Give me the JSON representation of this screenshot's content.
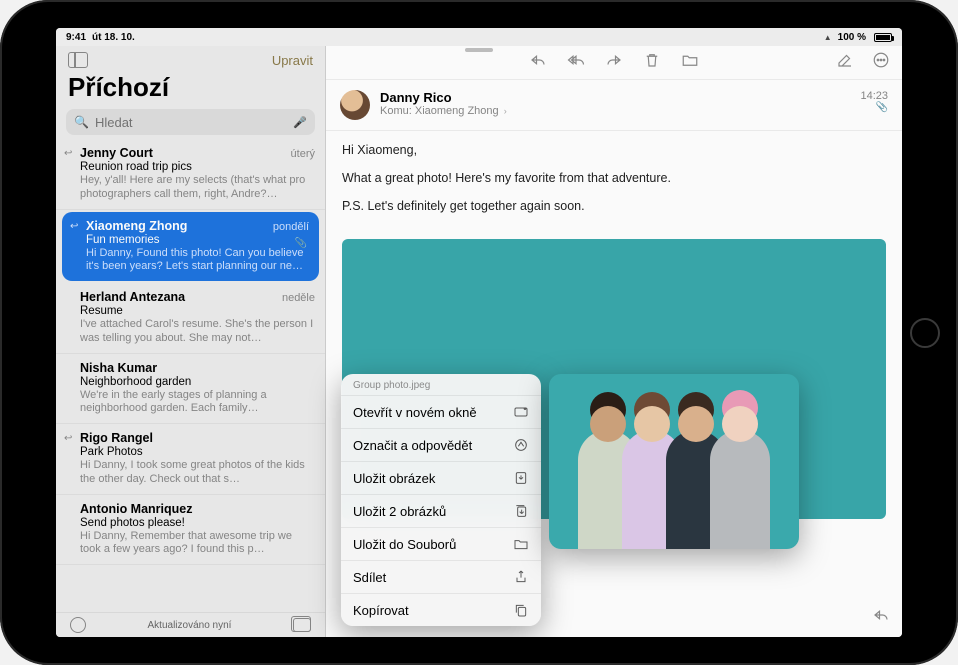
{
  "statusbar": {
    "time": "9:41",
    "date": "út 18. 10.",
    "battery": "100 %"
  },
  "sidebar": {
    "edit": "Upravit",
    "title": "Příchozí",
    "search_placeholder": "Hledat",
    "footer_status": "Aktualizováno nyní",
    "items": [
      {
        "sender": "Jenny Court",
        "time": "úterý",
        "subject": "Reunion road trip pics",
        "preview": "Hey, y'all! Here are my selects (that's what pro photographers call them, right, Andre?…",
        "replied": true
      },
      {
        "sender": "Xiaomeng Zhong",
        "time": "pondělí",
        "subject": "Fun memories",
        "preview": "Hi Danny, Found this photo! Can you believe it's been years? Let's start planning our ne…",
        "replied": true,
        "selected": true,
        "has_attachment": true
      },
      {
        "sender": "Herland Antezana",
        "time": "neděle",
        "subject": "Resume",
        "preview": "I've attached Carol's resume. She's the person I was telling you about. She may not…"
      },
      {
        "sender": "Nisha Kumar",
        "time": "",
        "subject": "Neighborhood garden",
        "preview": "We're in the early stages of planning a neighborhood garden. Each family…"
      },
      {
        "sender": "Rigo Rangel",
        "time": "",
        "subject": "Park Photos",
        "preview": "Hi Danny, I took some great photos of the kids the other day. Check out that s…",
        "replied": true
      },
      {
        "sender": "Antonio Manriquez",
        "time": "",
        "subject": "Send photos please!",
        "preview": "Hi Danny, Remember that awesome trip we took a few years ago? I found this p…"
      }
    ]
  },
  "message": {
    "from": "Danny Rico",
    "to_label": "Komu:",
    "to": "Xiaomeng Zhong",
    "time": "14:23",
    "body": {
      "p1": "Hi Xiaomeng,",
      "p2": "What a great photo! Here's my favorite from that adventure.",
      "p3": "P.S. Let's definitely get together again soon."
    }
  },
  "context_menu": {
    "title": "Group photo.jpeg",
    "items": [
      {
        "label": "Otevřít v novém okně",
        "icon": "open-window"
      },
      {
        "label": "Označit a odpovědět",
        "icon": "markup"
      },
      {
        "label": "Uložit obrázek",
        "icon": "save-down"
      },
      {
        "label": "Uložit 2 obrázků",
        "icon": "save-stack"
      },
      {
        "label": "Uložit do Souborů",
        "icon": "folder"
      },
      {
        "label": "Sdílet",
        "icon": "share"
      },
      {
        "label": "Kopírovat",
        "icon": "copy"
      }
    ]
  }
}
